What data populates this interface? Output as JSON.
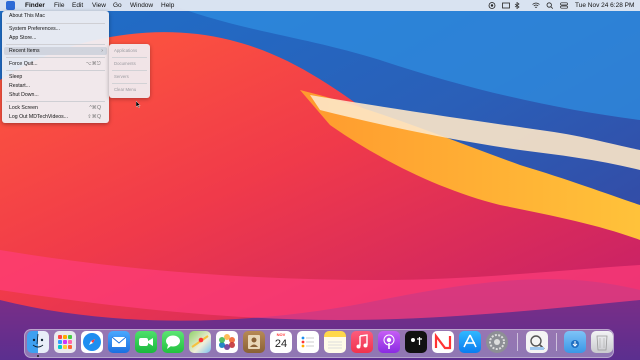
{
  "menubar": {
    "app_name": "Finder",
    "items": [
      "File",
      "Edit",
      "View",
      "Go",
      "Window",
      "Help"
    ],
    "clock": "Tue Nov 24  6:28 PM"
  },
  "apple_menu": {
    "about": "About This Mac",
    "system_prefs": "System Preferences...",
    "app_store": "App Store...",
    "recent_items": "Recent Items",
    "force_quit": "Force Quit...",
    "force_quit_shortcut": "⌥⌘⎋",
    "sleep": "Sleep",
    "restart": "Restart...",
    "shut_down": "Shut Down...",
    "lock_screen": "Lock Screen",
    "lock_shortcut": "^⌘Q",
    "log_out": "Log Out MDTechVideos...",
    "log_out_shortcut": "⇧⌘Q"
  },
  "recent_submenu": {
    "applications": "Applications",
    "documents": "Documents",
    "servers": "Servers",
    "clear_menu": "Clear Menu"
  },
  "dock": {
    "calendar_month": "NOV",
    "calendar_day": "24",
    "icons": [
      "finder-icon",
      "launchpad-icon",
      "safari-icon",
      "mail-icon",
      "facetime-icon",
      "messages-icon",
      "maps-icon",
      "photos-icon",
      "contacts-icon",
      "calendar-icon",
      "reminders-icon",
      "notes-icon",
      "music-icon",
      "podcasts-icon",
      "apple-tv-icon",
      "news-icon",
      "app-store-icon",
      "system-preferences-icon",
      "preview-icon",
      "downloads-folder-icon",
      "trash-icon"
    ]
  },
  "colors": {
    "accent": "#2d6bd6",
    "menu_highlight": "#cdd2dc"
  }
}
